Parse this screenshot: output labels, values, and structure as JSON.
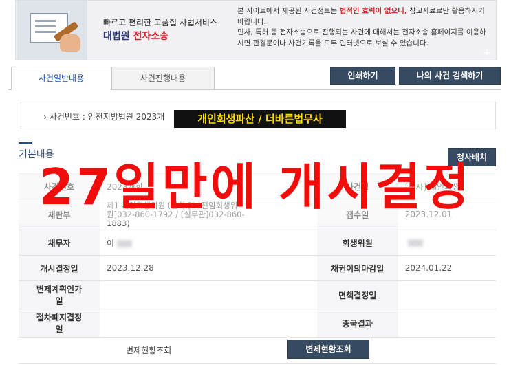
{
  "banner": {
    "title_line1": "빠르고 편리한 고품질 사법서비스",
    "title_org": "대법원",
    "title_service": "전자소송",
    "notice_part1": "본 사이트에서 제공된 사건정보는 ",
    "notice_highlight": "법적인 효력이 없으니,",
    "notice_part2": " 참고자료로만 활용하시기 바랍니다.",
    "notice_line2": "민사, 특허 등 전자소송으로 진행되는 사건에 대해서는 전자소송 홈페이지를 이용하시면 판결문이나 사건기록을 모두 인터넷으로 보실 수 있습니다.",
    "plus": "+"
  },
  "tabs": [
    {
      "label": "사건일반내용"
    },
    {
      "label": "사건진행내용"
    }
  ],
  "buttons": {
    "print": "인쇄하기",
    "my_case_search": "나의 사건 검색하기",
    "check": "청사배치",
    "repay_view": "변제현황조회"
  },
  "case": {
    "bullet": "›",
    "label": "사건번호 : 인천지방법원 2023개"
  },
  "overlay_caption": "개인회생파산 / 더바른법무사",
  "section_title": "기본내용",
  "table": {
    "row1": {
      "h1": "사건번호",
      "v1": "2023개회",
      "h2": "사건명",
      "tag": "[전자]",
      "v2": "개인회생"
    },
    "row2": {
      "h1": "재판부",
      "v1_line1": "제1 개인회생위원 (전화:[24전임회생위",
      "v1_line2": "원]032-860-1792 / [실무관]032-860-",
      "v1_line3": "1883)",
      "h2": "접수일",
      "v2": "2023.12.01"
    },
    "row3": {
      "h1": "채무자",
      "v1": "이",
      "h2": "회생위원",
      "v2": ""
    },
    "row4": {
      "h1": "개시결정일",
      "v1": "2023.12.28",
      "h2": "채권이의마감일",
      "v2": "2024.01.22"
    },
    "row5": {
      "h1_line1": "변제계획인가",
      "h1_line2": "일",
      "v1": "",
      "h2": "면책결정일",
      "v2": ""
    },
    "row6": {
      "h1_line1": "절차폐지결정",
      "h1_line2": "일",
      "v1": "",
      "h2": "종국결과",
      "v2": ""
    },
    "row7": {
      "label": "변제현황조회"
    }
  },
  "big_overlay": "27일만에 개시결정"
}
